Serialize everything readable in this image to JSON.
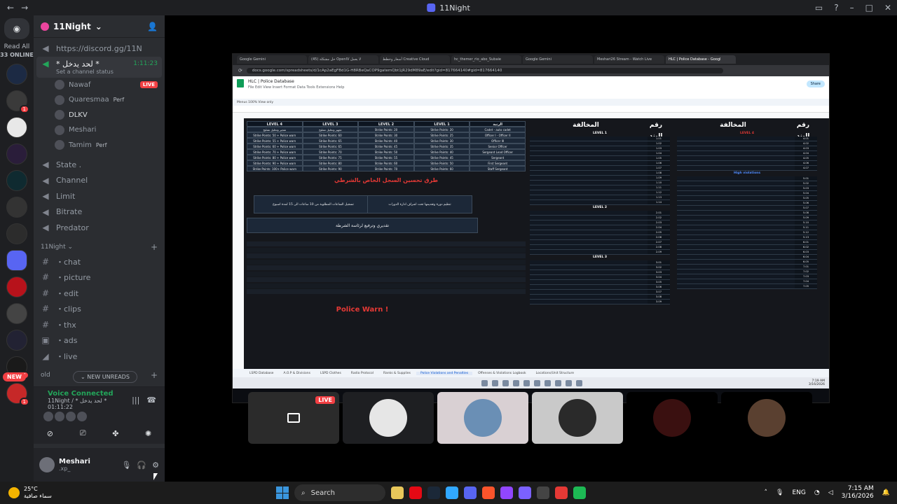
{
  "window": {
    "title": "11Night",
    "back_icon": "←",
    "forward_icon": "→"
  },
  "rail": {
    "read_all": "Read All",
    "online": "33 ONLINE",
    "new_pill": "NEW",
    "badges": [
      "1",
      "14",
      "1"
    ]
  },
  "server": {
    "name": "11Night"
  },
  "channels": {
    "invite": "https://discord.gg/11N",
    "voice_active": {
      "name": "* لحد يدخل *",
      "time": "1:11:23",
      "status": "Set a channel status"
    },
    "members": [
      {
        "name": "Nawaf",
        "live": "LIVE"
      },
      {
        "name": "Quaresmaa",
        "tag": "Perf"
      },
      {
        "name": "DLKV"
      },
      {
        "name": "Meshari"
      },
      {
        "name": "Tamim",
        "tag": "Perf"
      }
    ],
    "list": [
      "State .",
      "Channel",
      "Limit",
      "Bitrate",
      "Predator"
    ],
    "category": "11Night",
    "text": [
      "・chat",
      "・picture",
      "・edit",
      "・clips",
      "・thx",
      "・ads",
      "・live"
    ],
    "category2": "old",
    "new_unreads": "NEW UNREADS"
  },
  "voice": {
    "connected": "Voice Connected",
    "channel": "11Night / * لحد يدخل *",
    "time": "01:11:22"
  },
  "user": {
    "name": "Meshari",
    "status": ".xp_"
  },
  "stream": {
    "tabs": [
      "Google Gemini",
      "(45) حل مشكلة OpenIV لا يعمل",
      "أسعار وخطط Creative Cloud",
      "hc_themer_rio_abo_Subaie",
      "Google Gemini",
      "Meshari26 Stream - Watch Live",
      "HLC | Police Database - Googl"
    ],
    "url": "docs.google.com/spreadsheets/d/1cAp2aEgFBd1G-H8RBeQaCOP9gatemQbt1jR29dM89aE/edit?gid=817664140#gid=817664140",
    "doc_title": "HLC | Police Database",
    "menu": "File  Edit  View  Insert  Format  Data  Tools  Extensions  Help",
    "share": "Share",
    "toolbar": "Menus   100%   View only",
    "levels_head": [
      "LEVEL 4",
      "LEVEL 3",
      "LEVEL 2",
      "LEVEL 1",
      "الرتبة"
    ],
    "levels_rows": [
      [
        "تفجير وتحليل تشليح",
        "تجهيز وتحليل تشليح",
        "Strike Points: 20",
        "Strike Points: 20",
        "Cadet - auto cadet"
      ],
      [
        "Strike Points: 50 + Police warn",
        "Strike Points: 60",
        "Strike Points: 30",
        "Strike Points: 25",
        "Officer I - Officer II"
      ],
      [
        "Strike Points: 55 + Police warn",
        "Strike Points: 65",
        "Strike Points: 40",
        "Strike Points: 30",
        "Officer III"
      ],
      [
        "Strike Points: 60 + Police warn",
        "Strike Points: 65",
        "Strike Points: 45",
        "Strike Points: 35",
        "Senior Officer"
      ],
      [
        "Strike Points: 70 + Police warn",
        "Strike Points: 70",
        "Strike Points: 50",
        "Strike Points: 40",
        "Sergeant Lead Officer"
      ],
      [
        "Strike Points: 80 + Police warn",
        "Strike Points: 75",
        "Strike Points: 55",
        "Strike Points: 45",
        "Sergeant"
      ],
      [
        "Strike Points: 90 + Police warn",
        "Strike Points: 80",
        "Strike Points: 60",
        "Strike Points: 50",
        "First Sergeant"
      ],
      [
        "Strike Points: 100+ Police warn",
        "Strike Points: 90",
        "Strike Points: 70",
        "Strike Points: 60",
        "Staff Sergeant"
      ]
    ],
    "red_title": "طرق تحسين السجل الخاص بالشرطي",
    "box1": "تسجيل الساعات المطلوبة من 10 ساعات الى 15 لمدة اسبوع",
    "box2": "تنظيم دورة وتقديمها تحت اشراف ادارة الدورات",
    "box3": "تقديري وترفيع لرئاسة الشرطة",
    "police_warn": "Police Warn !",
    "violations_head": {
      "title": "المخالفة",
      "num": "رقم البند"
    },
    "level1": "LEVEL 1",
    "level2": "LEVEL 2",
    "level3": "LEVEL 3",
    "level4": "LEVEL 4",
    "high": "High violations",
    "v_nums_left": [
      "1.01",
      "1.02",
      "1.03",
      "1.04",
      "1.05",
      "1.06",
      "1.07",
      "1.08",
      "1.09",
      "1.10",
      "1.11",
      "1.12",
      "1.13",
      "1.14"
    ],
    "v_nums_left2": [
      "2.01",
      "2.02",
      "2.03",
      "2.04",
      "2.05",
      "2.06",
      "2.07",
      "2.08",
      "2.09"
    ],
    "v_nums_left3": [
      "3.01",
      "3.02",
      "3.03",
      "3.04",
      "3.05",
      "3.06",
      "3.07",
      "3.08",
      "3.09"
    ],
    "v_nums_right": [
      "4.01",
      "4.02",
      "4.03",
      "4.04",
      "4.05",
      "4.06",
      "4.07"
    ],
    "v_nums_right2": [
      "5.01",
      "5.02",
      "5.03",
      "5.04",
      "5.05",
      "5.06",
      "5.07",
      "5.08",
      "5.09",
      "5.10",
      "5.11",
      "5.12",
      "5.13"
    ],
    "v_nums_right3": [
      "6.01",
      "6.02",
      "6.03",
      "6.04",
      "6.05"
    ],
    "v_nums_right4": [
      "7.01",
      "7.02",
      "7.03",
      "7.04",
      "7.05"
    ],
    "sheet_tabs": [
      "LSPD Database",
      "A.O.P & Divisions",
      "LSPD Clothes",
      "Radio Protocol",
      "Ranks & Supplies",
      "Police Violations and Penalties",
      "Offenses & Violations Logbook",
      "Locations/Unit Structure"
    ],
    "active_sheet": "Police Violations and Penalties",
    "clock": "7:19 AM",
    "date": "3/16/2026"
  },
  "tiles": {
    "live": "LIVE"
  },
  "taskbar": {
    "temp": "25°C",
    "weather": "سماء صافية",
    "search": "Search",
    "lang": "ENG",
    "time": "7:15 AM",
    "date": "3/16/2026"
  },
  "colors": {
    "accent": "#5865f2",
    "online": "#23a55a",
    "live": "#f23f43"
  }
}
